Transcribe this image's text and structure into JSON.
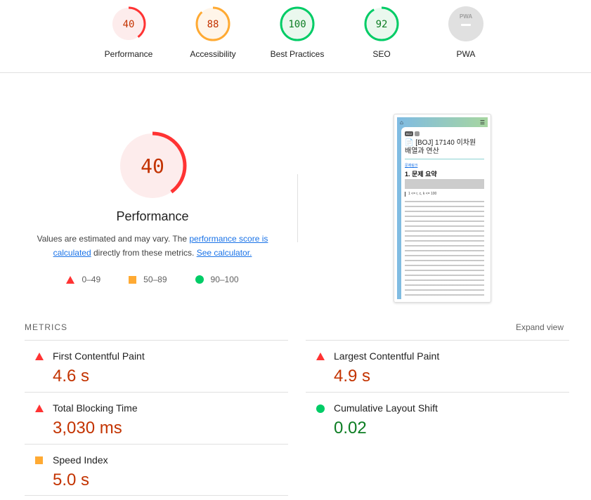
{
  "gauges": [
    {
      "label": "Performance",
      "score": "40",
      "value": 40,
      "color": "#f33",
      "bg": "#fdecec",
      "text": "#c33300"
    },
    {
      "label": "Accessibility",
      "score": "88",
      "value": 88,
      "color": "#fa3",
      "bg": "#fff5e9",
      "text": "#c33300"
    },
    {
      "label": "Best Practices",
      "score": "100",
      "value": 100,
      "color": "#0c6",
      "bg": "#eaf8ee",
      "text": "#0c7d23"
    },
    {
      "label": "SEO",
      "score": "92",
      "value": 92,
      "color": "#0c6",
      "bg": "#eaf8ee",
      "text": "#0c7d23"
    },
    {
      "label": "PWA",
      "badge": "PWA"
    }
  ],
  "main": {
    "score": "40",
    "value": 40,
    "title": "Performance",
    "desc_pre": "Values are estimated and may vary. The ",
    "desc_link": "performance score is calculated",
    "desc_mid": " directly from these metrics. ",
    "desc_link2": "See calculator.",
    "legend": [
      "0–49",
      "50–89",
      "90–100"
    ]
  },
  "thumbnail": {
    "tag": "BOJ",
    "title": "[BOJ] 17140 이차원 배열과 연산",
    "link": "문제링크",
    "heading": "1. 문제 요약",
    "formula": "1 <= r, c, k <= 100"
  },
  "metrics": {
    "header": "METRICS",
    "expand": "Expand view",
    "items": [
      {
        "name": "First Contentful Paint",
        "value": "4.6 s",
        "status": "fail"
      },
      {
        "name": "Largest Contentful Paint",
        "value": "4.9 s",
        "status": "fail"
      },
      {
        "name": "Total Blocking Time",
        "value": "3,030 ms",
        "status": "fail"
      },
      {
        "name": "Cumulative Layout Shift",
        "value": "0.02",
        "status": "pass"
      },
      {
        "name": "Speed Index",
        "value": "5.0 s",
        "status": "average"
      }
    ]
  }
}
